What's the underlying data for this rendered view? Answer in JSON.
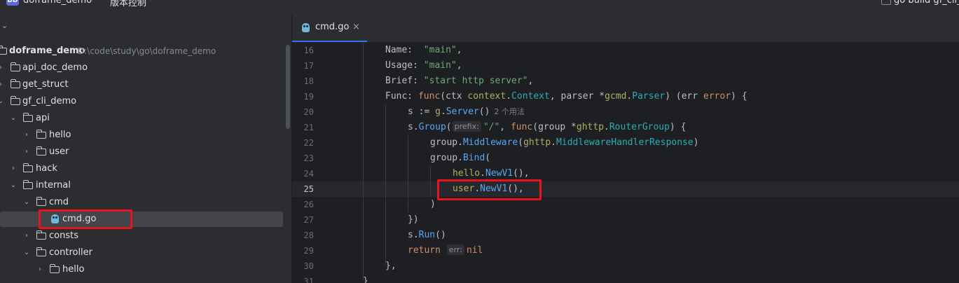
{
  "topbar": {
    "project_badge": "DD",
    "project_name": "doframe_demo",
    "vcs_label": "版本控制",
    "run_config": "go build gf_cli_d"
  },
  "tree": {
    "root_name": "doframe_demo",
    "root_path": "D:\\code\\study\\go\\doframe_demo",
    "items": [
      {
        "label": "api_doc_demo"
      },
      {
        "label": "get_struct"
      },
      {
        "label": "gf_cli_demo"
      },
      {
        "label": "api"
      },
      {
        "label": "hello"
      },
      {
        "label": "user"
      },
      {
        "label": "hack"
      },
      {
        "label": "internal"
      },
      {
        "label": "cmd"
      },
      {
        "label": "cmd.go"
      },
      {
        "label": "consts"
      },
      {
        "label": "controller"
      },
      {
        "label": "hello"
      }
    ]
  },
  "tab": {
    "label": "cmd.go",
    "close": "×"
  },
  "editor": {
    "active_line": 25,
    "lines": [
      16,
      17,
      18,
      19,
      20,
      21,
      22,
      23,
      24,
      25,
      26,
      27,
      28,
      29,
      30,
      31
    ],
    "code": {
      "l16_key": "Name:",
      "l16_val": "\"main\"",
      "l17_key": "Usage:",
      "l17_val": "\"main\"",
      "l18_key": "Brief:",
      "l18_val": "\"start http server\"",
      "l19_a": "Func:",
      "l19_func": "func",
      "l19_ctx": "(ctx ",
      "l19_context": "context",
      "l19_Context": "Context",
      "l19_parser": ", parser *",
      "l19_gcmd": "gcmd",
      "l19_Parser": "Parser",
      "l19_err": ") (err ",
      "l19_error": "error",
      "l19_end": ") {",
      "l20_a": "s := ",
      "l20_g": "g",
      "l20_Server": "Server",
      "l20_end": "()",
      "l20_hint": "2 个用法",
      "l21_s": "s.",
      "l21_Group": "Group",
      "l21_paren": "(",
      "l21_inlay": "prefix:",
      "l21_str": "\"/\"",
      "l21_comma": ", ",
      "l21_func": "func",
      "l21_grp": "(group *",
      "l21_ghttp": "ghttp",
      "l21_RouterGroup": "RouterGroup",
      "l21_end": ") {",
      "l22_a": "group.",
      "l22_Middleware": "Middleware",
      "l22_p": "(",
      "l22_ghttp": "ghttp",
      "l22_handler": "MiddlewareHandlerResponse",
      "l22_end": ")",
      "l23_a": "group.",
      "l23_Bind": "Bind",
      "l23_end": "(",
      "l24_pkg": "hello",
      "l24_fn": "NewV1",
      "l24_end": "(),",
      "l25_pkg": "user",
      "l25_fn": "NewV1",
      "l25_end": "(),",
      "l26": ")",
      "l27": "})",
      "l28_a": "s.",
      "l28_Run": "Run",
      "l28_end": "()",
      "l29_kw": "return",
      "l29_inlay": "err:",
      "l29_nil": "nil",
      "l30": "},",
      "l31": "}"
    }
  }
}
